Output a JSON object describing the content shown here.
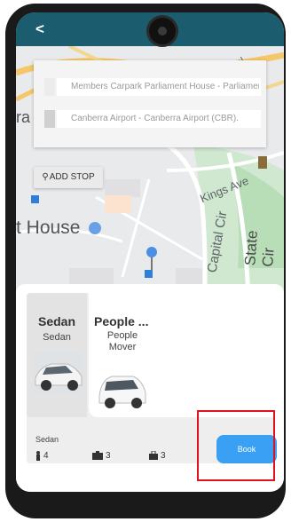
{
  "topbar": {
    "back_icon": "chevron-left-icon",
    "back_glyph": "<"
  },
  "map": {
    "labels": {
      "kings_ave": "Kings Ave",
      "capital_cir": "Capital Cir",
      "state_cir": "State Cir",
      "house": "t House",
      "edge_left": "ra",
      "top_right": "Mal"
    }
  },
  "route": {
    "pickup": "Members Carpark Parliament House - Parliament House",
    "dropoff": "Canberra Airport - Canberra Airport (CBR)."
  },
  "add_stop": {
    "label": "ADD STOP",
    "icon": "map-pin-icon"
  },
  "vehicles": [
    {
      "name": "Sedan",
      "description": "Sedan",
      "selected": true
    },
    {
      "name": "People ...",
      "description": "People Mover",
      "selected": false
    }
  ],
  "selected_vehicle": {
    "type": "Sedan",
    "passengers": "4",
    "large_bags": "3",
    "small_bags": "3"
  },
  "book_button": {
    "label": "Book"
  },
  "colors": {
    "header": "#1b5d6e",
    "book": "#3aa0f3",
    "highlight": "#e0121f",
    "park": "#c8e6c9",
    "road": "#f5c76a"
  }
}
